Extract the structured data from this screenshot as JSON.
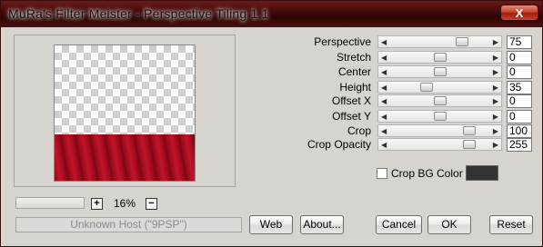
{
  "window": {
    "title": "MuRa's Filter Meister - Perspective Tiling 1.1",
    "close_label": "X"
  },
  "preview": {
    "zoom_in_label": "+",
    "zoom_out_label": "−",
    "zoom_value": "16%",
    "status": "Unknown Host (\"9PSP\")"
  },
  "params": [
    {
      "label": "Perspective",
      "value": "75",
      "level": 0.75
    },
    {
      "label": "Stretch",
      "value": "0",
      "level": 0.5
    },
    {
      "label": "Center",
      "value": "0",
      "level": 0.5
    },
    {
      "label": "Height",
      "value": "35",
      "level": 0.35
    },
    {
      "label": "Offset X",
      "value": "0",
      "level": 0.5
    },
    {
      "label": "Offset Y",
      "value": "0",
      "level": 0.5
    },
    {
      "label": "Crop",
      "value": "100",
      "level": 0.83
    },
    {
      "label": "Crop Opacity",
      "value": "255",
      "level": 0.83
    }
  ],
  "crop_bg": {
    "label": "Crop BG Color",
    "checked": false,
    "color": "#333232"
  },
  "buttons": {
    "web": "Web",
    "about": "About...",
    "cancel": "Cancel",
    "ok": "OK",
    "reset": "Reset"
  },
  "colors": {
    "title_bar": "#4a0c0c",
    "preview_red": "#b3112a",
    "close_button": "#c7402c"
  }
}
